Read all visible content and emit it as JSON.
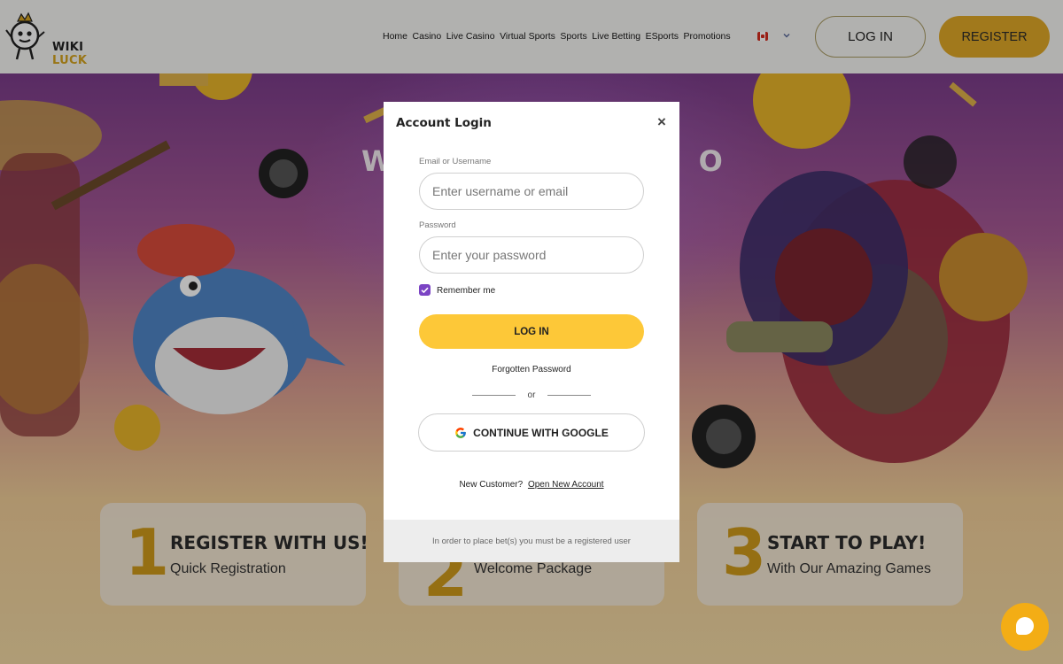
{
  "brand": {
    "line1": "WIKI",
    "line2": "LUCK"
  },
  "nav": [
    "Home",
    "Casino",
    "Live Casino",
    "Virtual Sports",
    "Sports",
    "Live Betting",
    "ESports",
    "Promotions"
  ],
  "header": {
    "login_label": "LOG IN",
    "register_label": "REGISTER"
  },
  "hero": {
    "title_left": "W",
    "title_right": "O"
  },
  "steps": [
    {
      "num": "1",
      "title": "REGISTER WITH US!",
      "sub": "Quick Registration"
    },
    {
      "num": "2",
      "title": "",
      "sub": "Welcome Package"
    },
    {
      "num": "3",
      "title": "START TO PLAY!",
      "sub": "With Our Amazing Games"
    }
  ],
  "modal": {
    "title": "Account Login",
    "close_glyph": "×",
    "email_label": "Email or Username",
    "email_placeholder": "Enter username or email",
    "password_label": "Password",
    "password_placeholder": "Enter your password",
    "remember_label": "Remember me",
    "login_button": "LOG IN",
    "forgot": "Forgotten Password",
    "or": "or",
    "google_button": "CONTINUE WITH GOOGLE",
    "new_customer": "New Customer?",
    "open_account": "Open New Account",
    "footer_note": "In order to place bet(s) you must be a registered user"
  },
  "colors": {
    "accent": "#e0a827",
    "login_yellow": "#fdc838",
    "checkbox": "#7b44c4",
    "chat": "#f3ad15"
  },
  "icons": {
    "close": "close-icon",
    "chevron": "chevron-down-icon",
    "google": "google-icon",
    "chat": "chat-icon",
    "flag": "canada-flag-icon",
    "check": "checkmark-icon"
  }
}
